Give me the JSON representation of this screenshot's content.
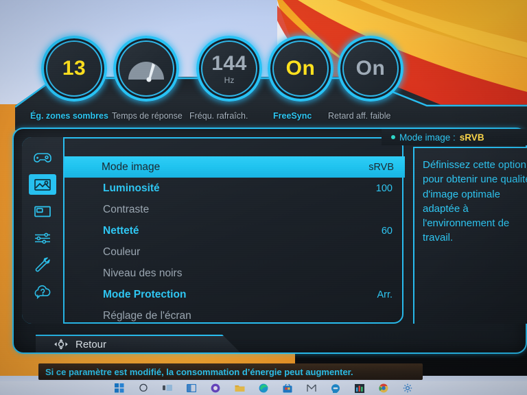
{
  "osd": {
    "dials": [
      {
        "name": "black-equalizer",
        "value": "13",
        "unit": "",
        "value_color": "#ffe11e",
        "caption": "Ég. zones sombres",
        "caption_active": true,
        "icon": ""
      },
      {
        "name": "response-time",
        "value": "",
        "unit": "",
        "value_color": "#9fabb7",
        "caption": "Temps de réponse",
        "caption_active": false,
        "icon": "gauge-icon"
      },
      {
        "name": "refresh-rate",
        "value": "144",
        "unit": "Hz",
        "value_color": "#9fabb7",
        "caption": "Fréqu. rafraîch.",
        "caption_active": false,
        "icon": ""
      },
      {
        "name": "freesync",
        "value": "On",
        "unit": "",
        "value_color": "#ffe11e",
        "caption": "FreeSync",
        "caption_active": true,
        "icon": ""
      },
      {
        "name": "low-input-lag",
        "value": "On",
        "unit": "",
        "value_color": "#9fabb7",
        "caption": "Retard aff. faible",
        "caption_active": false,
        "icon": ""
      }
    ],
    "sidebar": [
      {
        "name": "sidebar-item-game",
        "icon": "gamepad-icon",
        "selected": false
      },
      {
        "name": "sidebar-item-picture",
        "icon": "picture-icon",
        "selected": true
      },
      {
        "name": "sidebar-item-pip-pbp",
        "icon": "pip-pbp-icon",
        "selected": false
      },
      {
        "name": "sidebar-item-onscreen",
        "icon": "sliders-icon",
        "selected": false
      },
      {
        "name": "sidebar-item-system",
        "icon": "wrench-icon",
        "selected": false
      },
      {
        "name": "sidebar-item-support",
        "icon": "help-cloud-icon",
        "selected": false
      }
    ],
    "menu": [
      {
        "label": "Mode image",
        "value": "sRVB",
        "state": "selected"
      },
      {
        "label": "Luminosité",
        "value": "100",
        "state": "active"
      },
      {
        "label": "Contraste",
        "value": "",
        "state": "dim"
      },
      {
        "label": "Netteté",
        "value": "60",
        "state": "active"
      },
      {
        "label": "Couleur",
        "value": "",
        "state": "dim"
      },
      {
        "label": "Niveau des noirs",
        "value": "",
        "state": "dim"
      },
      {
        "label": "Mode Protection",
        "value": "Arr.",
        "state": "active"
      },
      {
        "label": "Réglage de l'écran",
        "value": "",
        "state": "dim"
      }
    ],
    "description": {
      "header_label": "Mode image :",
      "header_value": "sRVB",
      "body": "Définissez cette option pour obtenir une qualité d'image optimale adaptée à l'environnement de travail."
    },
    "back_button": {
      "label": "Retour",
      "icon": "dpad-icon"
    },
    "notice": "Si ce paramètre est modifié, la consommation d’énergie peut augmenter."
  },
  "taskbar": {
    "items": [
      {
        "name": "taskbar-start-button",
        "icon": "windows-logo-icon"
      },
      {
        "name": "taskbar-search-button",
        "icon": "search-circle-icon"
      },
      {
        "name": "taskbar-taskview-button",
        "icon": "task-view-icon"
      },
      {
        "name": "taskbar-widgets-button",
        "icon": "widgets-icon"
      },
      {
        "name": "taskbar-copilot-button",
        "icon": "copilot-icon"
      },
      {
        "name": "taskbar-file-explorer-button",
        "icon": "folder-icon"
      },
      {
        "name": "taskbar-edge-button",
        "icon": "edge-icon"
      },
      {
        "name": "taskbar-store-button",
        "icon": "store-icon"
      },
      {
        "name": "taskbar-mail-button",
        "icon": "mail-icon"
      },
      {
        "name": "taskbar-messaging-button",
        "icon": "chat-icon"
      },
      {
        "name": "taskbar-charts-button",
        "icon": "bar-chart-icon"
      },
      {
        "name": "taskbar-chrome-button",
        "icon": "chrome-icon"
      },
      {
        "name": "taskbar-settings-button",
        "icon": "gear-icon"
      }
    ]
  },
  "colors": {
    "accent_cyan": "#28bdf0",
    "highlight_cyan": "#1fc3ef",
    "value_yellow": "#ffe11e",
    "dim_gray": "#9aa6b1",
    "panel_dark": "#1a2027",
    "wallpaper_orange": "#eda130"
  }
}
